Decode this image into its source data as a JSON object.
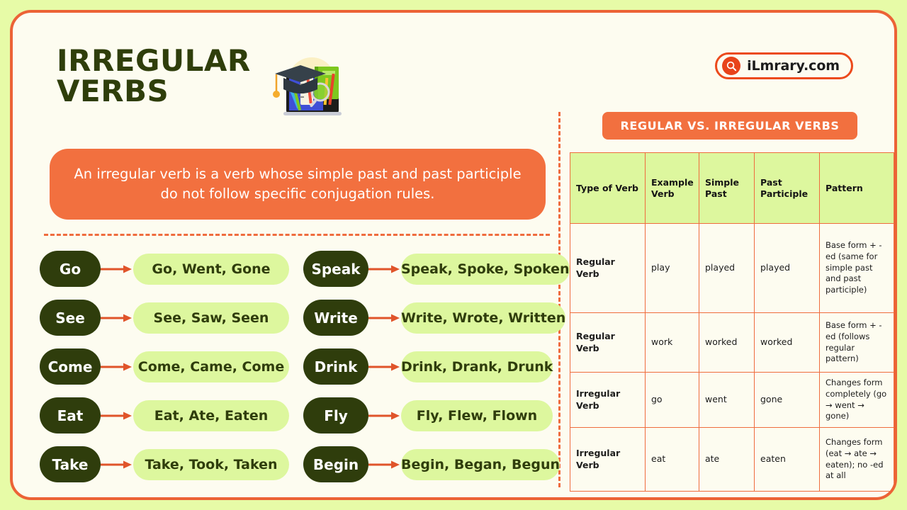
{
  "header": {
    "title_line1": "IRREGULAR",
    "title_line2": "VERBS",
    "illustration_name": "graduation-cap-study-supplies",
    "logo": {
      "text": "iLmrary.com",
      "icon": "magnifier-icon"
    }
  },
  "definition": {
    "text": "An irregular verb is a verb whose simple past and past participle do not follow specific conjugation rules."
  },
  "verbs": {
    "left": [
      {
        "verb": "Go",
        "forms": "Go, Went, Gone"
      },
      {
        "verb": "See",
        "forms": "See, Saw, Seen"
      },
      {
        "verb": "Come",
        "forms": "Come, Came, Come"
      },
      {
        "verb": "Eat",
        "forms": "Eat, Ate, Eaten"
      },
      {
        "verb": "Take",
        "forms": "Take, Took, Taken"
      }
    ],
    "right": [
      {
        "verb": "Speak",
        "forms": "Speak, Spoke, Spoken"
      },
      {
        "verb": "Write",
        "forms": "Write, Wrote, Written"
      },
      {
        "verb": "Drink",
        "forms": "Drink, Drank, Drunk"
      },
      {
        "verb": "Fly",
        "forms": "Fly, Flew, Flown"
      },
      {
        "verb": "Begin",
        "forms": "Begin, Began, Begun"
      }
    ]
  },
  "comparison": {
    "banner": "REGULAR VS. IRREGULAR VERBS",
    "columns": [
      "Type of Verb",
      "Example Verb",
      "Simple Past",
      "Past Participle",
      "Pattern"
    ],
    "rows": [
      {
        "type": "Regular Verb",
        "example": "play",
        "simple_past": "played",
        "past_participle": "played",
        "pattern": "Base form + -ed (same for simple past and past participle)"
      },
      {
        "type": "Regular Verb",
        "example": "work",
        "simple_past": "worked",
        "past_participle": "worked",
        "pattern": "Base form + -ed (follows regular pattern)"
      },
      {
        "type": "Irregular Verb",
        "example": "go",
        "simple_past": "went",
        "past_participle": "gone",
        "pattern": "Changes form completely (go → went → gone)"
      },
      {
        "type": "Irregular Verb",
        "example": "eat",
        "simple_past": "ate",
        "past_participle": "eaten",
        "pattern": "Changes form (eat → ate → eaten); no -ed at all"
      }
    ]
  },
  "colors": {
    "page_background": "#e7fba7",
    "card_background": "#fdfcf0",
    "accent_orange": "#ec6336",
    "banner_orange": "#f2703f",
    "dark_green": "#2f3d0c",
    "light_green": "#ddf79e",
    "logo_red": "#e8431a"
  }
}
